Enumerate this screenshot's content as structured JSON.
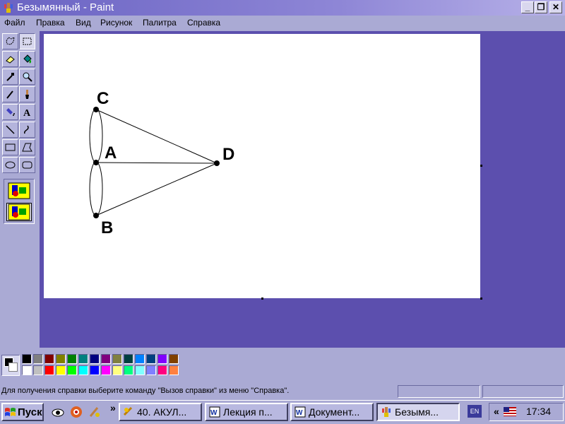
{
  "window": {
    "title": "Безымянный - Paint"
  },
  "menu": [
    "Файл",
    "Правка",
    "Вид",
    "Рисунок",
    "Палитра",
    "Справка"
  ],
  "canvas_drawing": {
    "points": [
      {
        "label": "C"
      },
      {
        "label": "A"
      },
      {
        "label": "D"
      },
      {
        "label": "B"
      }
    ]
  },
  "palette": {
    "top_row": [
      "#000000",
      "#808080",
      "#800000",
      "#808000",
      "#008000",
      "#008080",
      "#000080",
      "#800080",
      "#808040",
      "#004040",
      "#0080ff",
      "#004080",
      "#8000ff",
      "#804000"
    ],
    "bottom_row": [
      "#ffffff",
      "#c0c0c0",
      "#ff0000",
      "#ffff00",
      "#00ff00",
      "#00ffff",
      "#0000ff",
      "#ff00ff",
      "#ffff80",
      "#00ff80",
      "#80ffff",
      "#8080ff",
      "#ff0080",
      "#ff8040"
    ]
  },
  "status": {
    "help_text": "Для получения справки выберите команду \"Вызов справки\" из меню \"Справка\"."
  },
  "taskbar": {
    "start_label": "Пуск",
    "tasks": [
      {
        "label": "40. АКУЛ..."
      },
      {
        "label": "Лекция п..."
      },
      {
        "label": "Документ..."
      },
      {
        "label": "Безымя..."
      }
    ],
    "lang": "EN",
    "tray_arrow": "«",
    "clock": "17:34"
  }
}
